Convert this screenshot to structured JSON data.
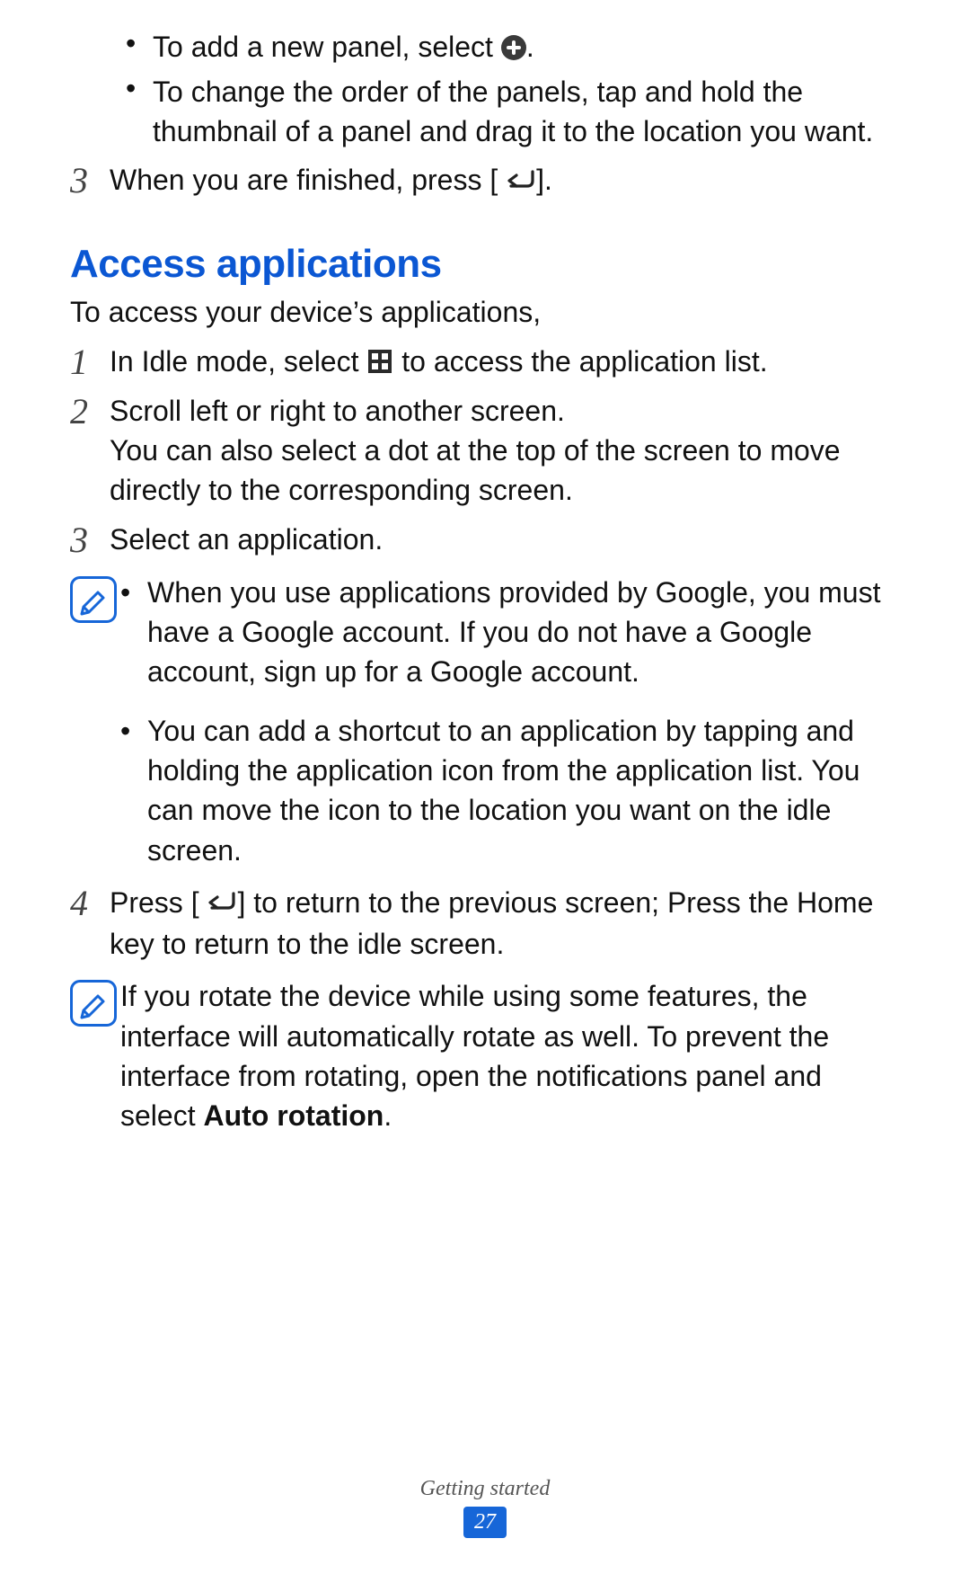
{
  "top": {
    "bullets": [
      {
        "pre": "To add a new panel, select ",
        "post": "."
      },
      {
        "text": "To change the order of the panels, tap and hold the thumbnail of a panel and drag it to the location you want."
      }
    ],
    "step3": {
      "pre": "When you are finished, press [",
      "post": "]."
    }
  },
  "heading": "Access applications",
  "lead": "To access your device’s applications,",
  "steps": {
    "s1": {
      "pre": "In Idle mode, select ",
      "post": " to access the application list."
    },
    "s2": {
      "line1": "Scroll left or right to another screen.",
      "line2": "You can also select a dot at the top of the screen to move directly to the corresponding screen."
    },
    "s3": {
      "text": "Select an application."
    },
    "s4": {
      "pre": "Press [",
      "post": "] to return to the previous screen; Press the Home key to return to the idle screen."
    }
  },
  "notes": {
    "n1": {
      "b1": "When you use applications provided by Google, you must have a Google account. If you do not have a Google account, sign up for a Google account.",
      "b2": "You can add a shortcut to an application by tapping and holding the application icon from the application list. You can move the icon to the location you want on the idle screen."
    },
    "n2": {
      "pre": "If you rotate the device while using some features, the interface will automatically rotate as well. To prevent the interface from rotating, open the notifications panel and select ",
      "bold": "Auto rotation",
      "post": "."
    }
  },
  "footer": {
    "section": "Getting started",
    "page": "27"
  }
}
